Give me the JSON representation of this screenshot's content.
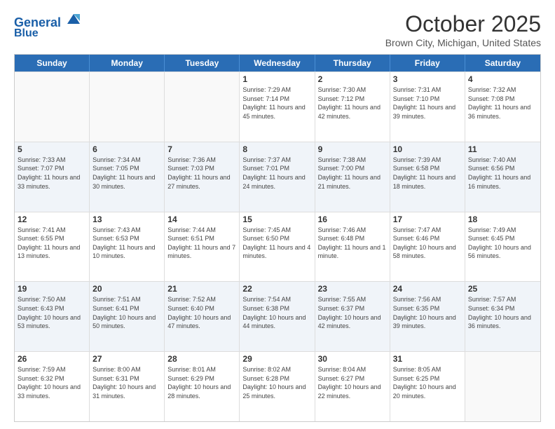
{
  "logo": {
    "line1": "General",
    "line2": "Blue"
  },
  "title": "October 2025",
  "location": "Brown City, Michigan, United States",
  "weekdays": [
    "Sunday",
    "Monday",
    "Tuesday",
    "Wednesday",
    "Thursday",
    "Friday",
    "Saturday"
  ],
  "weeks": [
    [
      {
        "day": "",
        "empty": true
      },
      {
        "day": "",
        "empty": true
      },
      {
        "day": "",
        "empty": true
      },
      {
        "day": "1",
        "sunrise": "7:29 AM",
        "sunset": "7:14 PM",
        "daylight": "11 hours and 45 minutes."
      },
      {
        "day": "2",
        "sunrise": "7:30 AM",
        "sunset": "7:12 PM",
        "daylight": "11 hours and 42 minutes."
      },
      {
        "day": "3",
        "sunrise": "7:31 AM",
        "sunset": "7:10 PM",
        "daylight": "11 hours and 39 minutes."
      },
      {
        "day": "4",
        "sunrise": "7:32 AM",
        "sunset": "7:08 PM",
        "daylight": "11 hours and 36 minutes."
      }
    ],
    [
      {
        "day": "5",
        "sunrise": "7:33 AM",
        "sunset": "7:07 PM",
        "daylight": "11 hours and 33 minutes."
      },
      {
        "day": "6",
        "sunrise": "7:34 AM",
        "sunset": "7:05 PM",
        "daylight": "11 hours and 30 minutes."
      },
      {
        "day": "7",
        "sunrise": "7:36 AM",
        "sunset": "7:03 PM",
        "daylight": "11 hours and 27 minutes."
      },
      {
        "day": "8",
        "sunrise": "7:37 AM",
        "sunset": "7:01 PM",
        "daylight": "11 hours and 24 minutes."
      },
      {
        "day": "9",
        "sunrise": "7:38 AM",
        "sunset": "7:00 PM",
        "daylight": "11 hours and 21 minutes."
      },
      {
        "day": "10",
        "sunrise": "7:39 AM",
        "sunset": "6:58 PM",
        "daylight": "11 hours and 18 minutes."
      },
      {
        "day": "11",
        "sunrise": "7:40 AM",
        "sunset": "6:56 PM",
        "daylight": "11 hours and 16 minutes."
      }
    ],
    [
      {
        "day": "12",
        "sunrise": "7:41 AM",
        "sunset": "6:55 PM",
        "daylight": "11 hours and 13 minutes."
      },
      {
        "day": "13",
        "sunrise": "7:43 AM",
        "sunset": "6:53 PM",
        "daylight": "11 hours and 10 minutes."
      },
      {
        "day": "14",
        "sunrise": "7:44 AM",
        "sunset": "6:51 PM",
        "daylight": "11 hours and 7 minutes."
      },
      {
        "day": "15",
        "sunrise": "7:45 AM",
        "sunset": "6:50 PM",
        "daylight": "11 hours and 4 minutes."
      },
      {
        "day": "16",
        "sunrise": "7:46 AM",
        "sunset": "6:48 PM",
        "daylight": "11 hours and 1 minute."
      },
      {
        "day": "17",
        "sunrise": "7:47 AM",
        "sunset": "6:46 PM",
        "daylight": "10 hours and 58 minutes."
      },
      {
        "day": "18",
        "sunrise": "7:49 AM",
        "sunset": "6:45 PM",
        "daylight": "10 hours and 56 minutes."
      }
    ],
    [
      {
        "day": "19",
        "sunrise": "7:50 AM",
        "sunset": "6:43 PM",
        "daylight": "10 hours and 53 minutes."
      },
      {
        "day": "20",
        "sunrise": "7:51 AM",
        "sunset": "6:41 PM",
        "daylight": "10 hours and 50 minutes."
      },
      {
        "day": "21",
        "sunrise": "7:52 AM",
        "sunset": "6:40 PM",
        "daylight": "10 hours and 47 minutes."
      },
      {
        "day": "22",
        "sunrise": "7:54 AM",
        "sunset": "6:38 PM",
        "daylight": "10 hours and 44 minutes."
      },
      {
        "day": "23",
        "sunrise": "7:55 AM",
        "sunset": "6:37 PM",
        "daylight": "10 hours and 42 minutes."
      },
      {
        "day": "24",
        "sunrise": "7:56 AM",
        "sunset": "6:35 PM",
        "daylight": "10 hours and 39 minutes."
      },
      {
        "day": "25",
        "sunrise": "7:57 AM",
        "sunset": "6:34 PM",
        "daylight": "10 hours and 36 minutes."
      }
    ],
    [
      {
        "day": "26",
        "sunrise": "7:59 AM",
        "sunset": "6:32 PM",
        "daylight": "10 hours and 33 minutes."
      },
      {
        "day": "27",
        "sunrise": "8:00 AM",
        "sunset": "6:31 PM",
        "daylight": "10 hours and 31 minutes."
      },
      {
        "day": "28",
        "sunrise": "8:01 AM",
        "sunset": "6:29 PM",
        "daylight": "10 hours and 28 minutes."
      },
      {
        "day": "29",
        "sunrise": "8:02 AM",
        "sunset": "6:28 PM",
        "daylight": "10 hours and 25 minutes."
      },
      {
        "day": "30",
        "sunrise": "8:04 AM",
        "sunset": "6:27 PM",
        "daylight": "10 hours and 22 minutes."
      },
      {
        "day": "31",
        "sunrise": "8:05 AM",
        "sunset": "6:25 PM",
        "daylight": "10 hours and 20 minutes."
      },
      {
        "day": "",
        "empty": true
      }
    ]
  ]
}
